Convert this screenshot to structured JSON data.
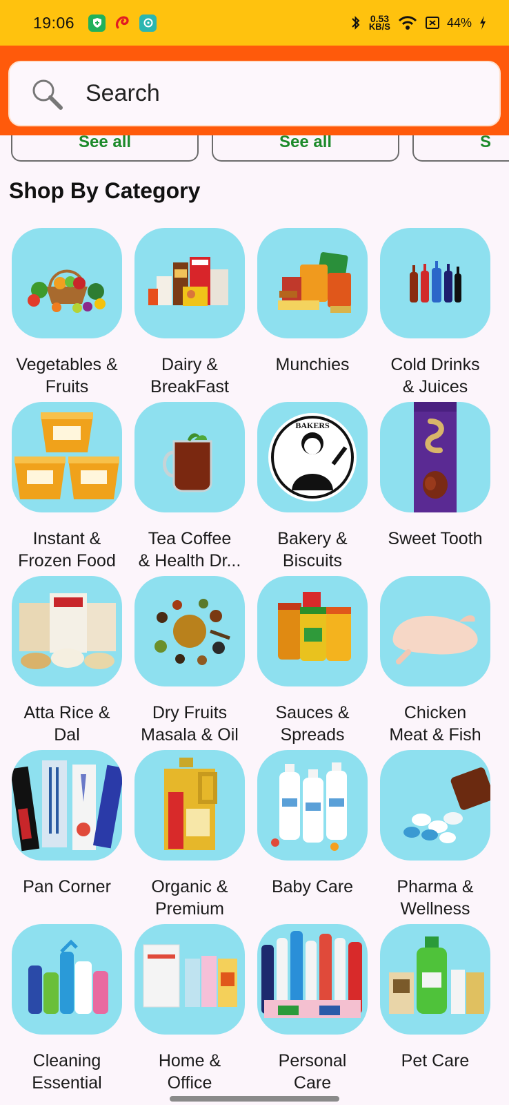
{
  "status_bar": {
    "time": "19:06",
    "speed_value": "0.53",
    "speed_unit": "KB/S",
    "battery": "44%"
  },
  "search": {
    "placeholder": "Search"
  },
  "see_all": [
    "See all",
    "See all",
    "S"
  ],
  "section_title": "Shop By Category",
  "categories": [
    {
      "label": "Vegetables &\nFruits",
      "icon": "vegetables-fruits-icon"
    },
    {
      "label": "Dairy &\nBreakFast",
      "icon": "dairy-breakfast-icon"
    },
    {
      "label": "Munchies",
      "icon": "munchies-icon"
    },
    {
      "label": "Cold Drinks\n& Juices",
      "icon": "cold-drinks-icon"
    },
    {
      "label": "Instant &\nFrozen Food",
      "icon": "instant-noodles-icon"
    },
    {
      "label": "Tea Coffee\n& Health Dr...",
      "icon": "tea-cup-icon"
    },
    {
      "label": "Bakery &\nBiscuits",
      "icon": "bakers-logo-icon"
    },
    {
      "label": "Sweet Tooth",
      "icon": "chocolate-bar-icon"
    },
    {
      "label": "Atta Rice &\nDal",
      "icon": "atta-rice-icon"
    },
    {
      "label": "Dry Fruits\nMasala & Oil",
      "icon": "spices-icon"
    },
    {
      "label": "Sauces &\nSpreads",
      "icon": "sauces-jars-icon"
    },
    {
      "label": "Chicken\nMeat & Fish",
      "icon": "chicken-icon"
    },
    {
      "label": "Pan Corner",
      "icon": "pencils-icon"
    },
    {
      "label": "Organic &\nPremium",
      "icon": "oil-can-icon"
    },
    {
      "label": "Baby Care",
      "icon": "baby-bottles-icon"
    },
    {
      "label": "Pharma &\nWellness",
      "icon": "pills-icon"
    },
    {
      "label": "Cleaning\nEssential",
      "icon": "cleaning-bottles-icon"
    },
    {
      "label": "Home &\nOffice",
      "icon": "home-office-icon"
    },
    {
      "label": "Personal\nCare",
      "icon": "personal-care-icon"
    },
    {
      "label": "Pet Care",
      "icon": "pet-care-icon"
    }
  ],
  "colors": {
    "status_bar": "#ffc20e",
    "header": "#ff5a0b",
    "tile": "#8ee0ef",
    "see_all_text": "#1c8a2a"
  }
}
